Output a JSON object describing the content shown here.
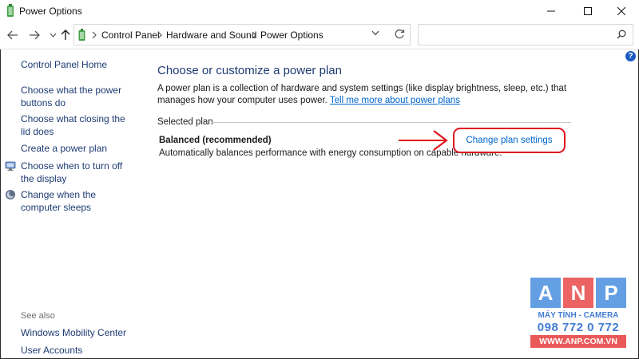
{
  "window": {
    "title": "Power Options",
    "icon": "battery-icon",
    "controls": [
      "minimize-icon",
      "maximize-icon",
      "close-icon"
    ]
  },
  "nav": {
    "back_icon": "back-arrow-icon",
    "forward_icon": "forward-arrow-icon",
    "recent_icon": "chevron-down-icon",
    "up_icon": "up-arrow-icon",
    "breadcrumb": [
      "Control Panel",
      "Hardware and Sound",
      "Power Options"
    ],
    "refresh_icon": "refresh-icon",
    "search": {
      "value": "",
      "icon": "search-icon"
    }
  },
  "sidebar": {
    "home": "Control Panel Home",
    "links": [
      {
        "label": "Choose what the power buttons do",
        "icon": null
      },
      {
        "label": "Choose what closing the lid does",
        "icon": null
      },
      {
        "label": "Create a power plan",
        "icon": null
      },
      {
        "label": "Choose when to turn off the display",
        "icon": "monitor-icon"
      },
      {
        "label": "Change when the computer sleeps",
        "icon": "moon-icon"
      }
    ],
    "see_also_heading": "See also",
    "see_also": [
      "Windows Mobility Center",
      "User Accounts"
    ]
  },
  "main": {
    "title": "Choose or customize a power plan",
    "description": "A power plan is a collection of hardware and system settings (like display brightness, sleep, etc.) that manages how your computer uses power.",
    "learn_more": "Tell me more about power plans",
    "selected_plan_label": "Selected plan",
    "plan_name": "Balanced (recommended)",
    "plan_description": "Automatically balances performance with energy consumption on capable hardware.",
    "change_link": "Change plan settings",
    "help_label": "?"
  },
  "watermark": {
    "letters": [
      "A",
      "N",
      "P"
    ],
    "tagline": "MÁY TÍNH - CAMERA",
    "phone": "098 772 0 772",
    "website": "WWW.ANP.COM.VN"
  },
  "colors": {
    "link": "#1e3b73",
    "hyperlink": "#0066cc",
    "highlight": "#e0141e",
    "watermark_blue": "#4a8fe0",
    "watermark_red": "#e83a3a"
  }
}
